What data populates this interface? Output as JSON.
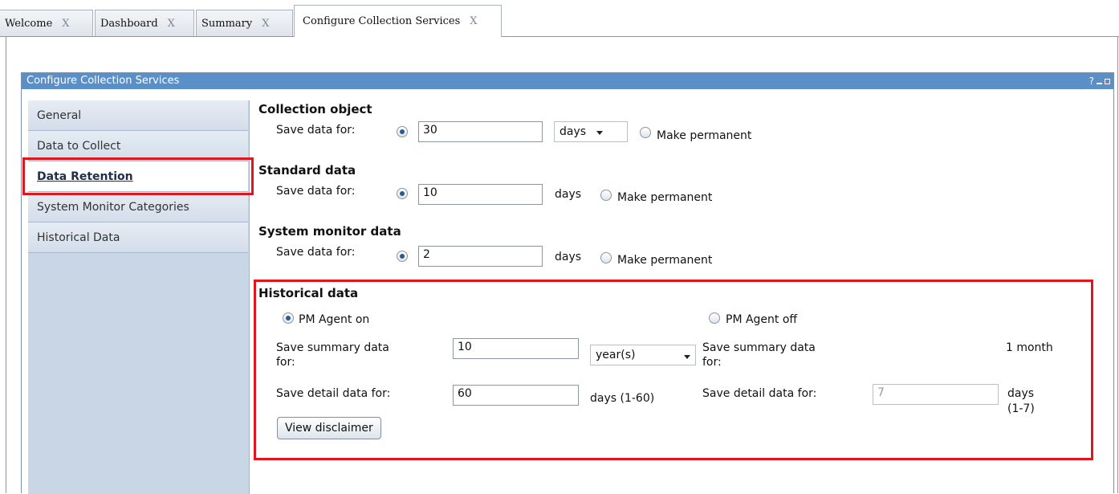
{
  "tabs": [
    {
      "label": "Welcome",
      "close": "X"
    },
    {
      "label": "Dashboard",
      "close": "X"
    },
    {
      "label": "Summary",
      "close": "X"
    },
    {
      "label": "Configure Collection Services",
      "close": "X"
    }
  ],
  "window": {
    "title": "Configure Collection Services",
    "help": "?"
  },
  "sidebar": {
    "items": [
      {
        "label": "General"
      },
      {
        "label": "Data to Collect"
      },
      {
        "label": "Data Retention"
      },
      {
        "label": "System Monitor Categories"
      },
      {
        "label": "Historical Data"
      }
    ]
  },
  "collection_object": {
    "heading": "Collection object",
    "label": "Save data for:",
    "value": "30",
    "unit_select": "days",
    "permanent_label": "Make permanent"
  },
  "standard_data": {
    "heading": "Standard data",
    "label": "Save data for:",
    "value": "10",
    "unit": "days",
    "permanent_label": "Make permanent"
  },
  "system_monitor_data": {
    "heading": "System monitor data",
    "label": "Save data for:",
    "value": "2",
    "unit": "days",
    "permanent_label": "Make permanent"
  },
  "historical_data": {
    "heading": "Historical data",
    "pm_on_label": "PM Agent on",
    "pm_off_label": "PM Agent off",
    "on": {
      "summary_label_1": "Save summary data",
      "summary_label_2": "for:",
      "summary_value": "10",
      "summary_unit": "year(s)",
      "detail_label": "Save detail data for:",
      "detail_value": "60",
      "detail_unit": "days (1-60)"
    },
    "off": {
      "summary_label_1": "Save summary data",
      "summary_label_2": "for:",
      "summary_value": "1 month",
      "detail_label": "Save detail data for:",
      "detail_value": "7",
      "detail_unit_1": "days",
      "detail_unit_2": "(1-7)"
    },
    "disclaimer_button": "View disclaimer"
  }
}
